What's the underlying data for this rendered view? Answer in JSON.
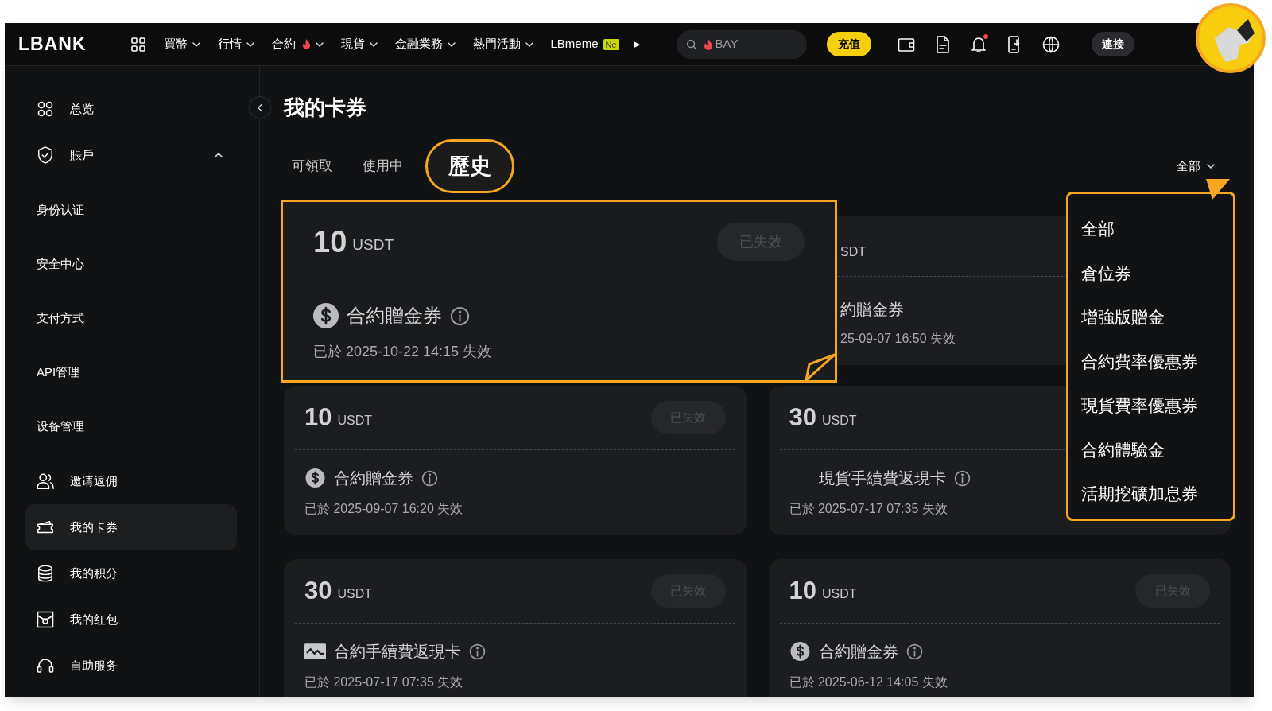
{
  "nav": {
    "logo": "LBANK",
    "menu": [
      {
        "label": "買幣",
        "hot": false,
        "caret": true
      },
      {
        "label": "行情",
        "hot": false,
        "caret": true
      },
      {
        "label": "合約",
        "hot": true,
        "caret": true
      },
      {
        "label": "現貨",
        "hot": false,
        "caret": true
      },
      {
        "label": "金融業務",
        "hot": false,
        "caret": true
      },
      {
        "label": "熱門活動",
        "hot": false,
        "caret": true
      },
      {
        "label": "LBmeme",
        "hot": false,
        "caret": false,
        "badge": "Ne"
      }
    ],
    "more": "▶",
    "search": {
      "placeholder": "BAY"
    },
    "deposit": "充值",
    "notifications_unread": true,
    "connect": "連接"
  },
  "sidebar": [
    {
      "label": "总览",
      "kind": "overview",
      "selected": false
    },
    {
      "label": "賬戶",
      "kind": "shield",
      "selected": false,
      "expanded": true,
      "children": [
        {
          "label": "身份认证",
          "selected": false
        },
        {
          "label": "安全中心",
          "selected": false
        },
        {
          "label": "支付方式",
          "selected": false
        },
        {
          "label": "API管理",
          "selected": false
        },
        {
          "label": "设备管理",
          "selected": false
        }
      ]
    },
    {
      "label": "邀请返佣",
      "kind": "users",
      "selected": false
    },
    {
      "label": "我的卡券",
      "kind": "ticket",
      "selected": true
    },
    {
      "label": "我的积分",
      "kind": "coins",
      "selected": false
    },
    {
      "label": "我的红包",
      "kind": "envelope",
      "selected": false
    },
    {
      "label": "自助服务",
      "kind": "headset",
      "selected": false
    }
  ],
  "title": "我的卡券",
  "tabs": [
    {
      "label": "可領取",
      "selected": false
    },
    {
      "label": "使用中",
      "selected": false
    },
    {
      "label": "歷史",
      "selected": true
    }
  ],
  "filter": {
    "value": "全部",
    "options": [
      {
        "label": "全部"
      },
      {
        "label": "倉位券"
      },
      {
        "label": "增強版贈金"
      },
      {
        "label": "合約費率優惠券"
      },
      {
        "label": "現貨費率優惠券"
      },
      {
        "label": "合約體驗金"
      },
      {
        "label": "活期挖礦加息券"
      }
    ]
  },
  "featured_card": {
    "amount": "10",
    "unit": "USDT",
    "status": "已失效",
    "kind": "dollar",
    "name": "合約贈金券",
    "date": "已於 2025-10-22 14:15 失效"
  },
  "covered_card": {
    "unit": "SDT",
    "name": "約贈金券",
    "date": "25-09-07 16:50 失效"
  },
  "cards": [
    {
      "amount": "10",
      "unit": "USDT",
      "status": "已失效",
      "kind": "dollar",
      "name": "合約贈金券",
      "date": "已於 2025-09-07 16:20 失效"
    },
    {
      "amount": "30",
      "unit": "USDT",
      "kind": "plain",
      "name": "現貨手續費返現卡",
      "date": "已於 2025-07-17 07:35 失效"
    },
    {
      "amount": "30",
      "unit": "USDT",
      "status": "已失效",
      "kind": "rebate",
      "name": "合約手續費返現卡",
      "date": "已於 2025-07-17 07:35 失效"
    },
    {
      "amount": "10",
      "unit": "USDT",
      "status": "已失效",
      "kind": "dollar",
      "name": "合約贈金券",
      "date": "已於 2025-06-12 14:05 失效"
    }
  ]
}
